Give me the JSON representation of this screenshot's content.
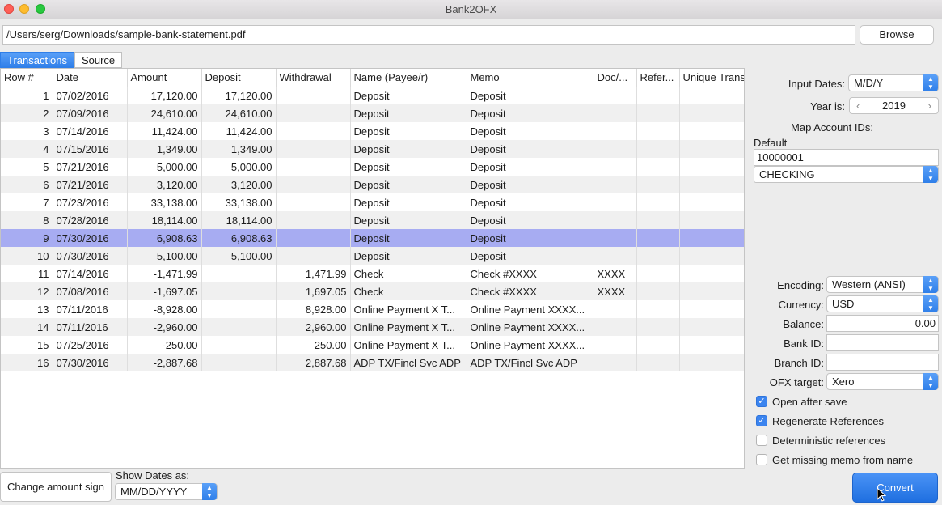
{
  "window": {
    "title": "Bank2OFX"
  },
  "file": {
    "path": "/Users/serg/Downloads/sample-bank-statement.pdf",
    "browse_label": "Browse"
  },
  "tabs": [
    {
      "label": "Transactions",
      "active": true
    },
    {
      "label": "Source",
      "active": false
    }
  ],
  "table": {
    "columns": [
      "Row #",
      "Date",
      "Amount",
      "Deposit",
      "Withdrawal",
      "Name (Payee/r)",
      "Memo",
      "Doc/...",
      "Refer...",
      "Unique Trans"
    ],
    "selected_row": 9,
    "rows": [
      [
        "1",
        "07/02/2016",
        "17,120.00",
        "17,120.00",
        "",
        "Deposit",
        "Deposit",
        "",
        "",
        ""
      ],
      [
        "2",
        "07/09/2016",
        "24,610.00",
        "24,610.00",
        "",
        "Deposit",
        "Deposit",
        "",
        "",
        ""
      ],
      [
        "3",
        "07/14/2016",
        "11,424.00",
        "11,424.00",
        "",
        "Deposit",
        "Deposit",
        "",
        "",
        ""
      ],
      [
        "4",
        "07/15/2016",
        "1,349.00",
        "1,349.00",
        "",
        "Deposit",
        "Deposit",
        "",
        "",
        ""
      ],
      [
        "5",
        "07/21/2016",
        "5,000.00",
        "5,000.00",
        "",
        "Deposit",
        "Deposit",
        "",
        "",
        ""
      ],
      [
        "6",
        "07/21/2016",
        "3,120.00",
        "3,120.00",
        "",
        "Deposit",
        "Deposit",
        "",
        "",
        ""
      ],
      [
        "7",
        "07/23/2016",
        "33,138.00",
        "33,138.00",
        "",
        "Deposit",
        "Deposit",
        "",
        "",
        ""
      ],
      [
        "8",
        "07/28/2016",
        "18,114.00",
        "18,114.00",
        "",
        "Deposit",
        "Deposit",
        "",
        "",
        ""
      ],
      [
        "9",
        "07/30/2016",
        "6,908.63",
        "6,908.63",
        "",
        "Deposit",
        "Deposit",
        "",
        "",
        ""
      ],
      [
        "10",
        "07/30/2016",
        "5,100.00",
        "5,100.00",
        "",
        "Deposit",
        "Deposit",
        "",
        "",
        ""
      ],
      [
        "11",
        "07/14/2016",
        "-1,471.99",
        "",
        "1,471.99",
        "Check",
        "Check #XXXX",
        "XXXX",
        "",
        ""
      ],
      [
        "12",
        "07/08/2016",
        "-1,697.05",
        "",
        "1,697.05",
        "Check",
        "Check #XXXX",
        "XXXX",
        "",
        ""
      ],
      [
        "13",
        "07/11/2016",
        "-8,928.00",
        "",
        "8,928.00",
        "Online Payment X T...",
        "Online Payment XXXX...",
        "",
        "",
        ""
      ],
      [
        "14",
        "07/11/2016",
        "-2,960.00",
        "",
        "2,960.00",
        "Online Payment X T...",
        "Online Payment XXXX...",
        "",
        "",
        ""
      ],
      [
        "15",
        "07/25/2016",
        "-250.00",
        "",
        "250.00",
        "Online Payment X T...",
        "Online Payment XXXX...",
        "",
        "",
        ""
      ],
      [
        "16",
        "07/30/2016",
        "-2,887.68",
        "",
        "2,887.68",
        "ADP TX/Fincl Svc ADP",
        "ADP TX/Fincl Svc ADP",
        "",
        "",
        ""
      ]
    ]
  },
  "panel": {
    "input_dates_label": "Input Dates:",
    "input_dates_value": "M/D/Y",
    "year_label": "Year is:",
    "year_value": "2019",
    "map_label": "Map Account IDs:",
    "default_label": "Default",
    "account_id": "10000001",
    "account_type": "CHECKING",
    "encoding_label": "Encoding:",
    "encoding_value": "Western (ANSI)",
    "currency_label": "Currency:",
    "currency_value": "USD",
    "balance_label": "Balance:",
    "balance_value": "0.00",
    "bank_id_label": "Bank ID:",
    "bank_id_value": "",
    "branch_id_label": "Branch ID:",
    "branch_id_value": "",
    "ofx_label": "OFX target:",
    "ofx_value": "Xero",
    "checks": [
      {
        "label": "Open after save",
        "checked": true
      },
      {
        "label": "Regenerate References",
        "checked": true
      },
      {
        "label": "Deterministic references",
        "checked": false
      },
      {
        "label": "Get missing memo from name",
        "checked": false
      }
    ]
  },
  "bottom": {
    "amount_sign_label": "Change amount sign",
    "show_dates_label": "Show Dates as:",
    "show_dates_value": "MM/DD/YYYY",
    "convert_label": "Convert"
  }
}
